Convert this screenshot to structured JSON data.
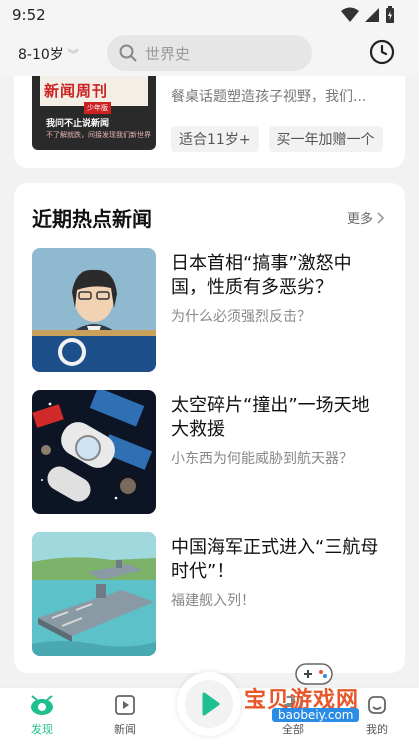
{
  "status_bar": {
    "time": "9:52"
  },
  "header": {
    "age_selector": "8-10岁",
    "search_placeholder": "世界史"
  },
  "featured_card": {
    "magazine": {
      "title": "新闻周刊",
      "edition": "少年版",
      "headline": "我问不止说新闻",
      "subline": "不了解就跌，间接发现我们新世界"
    },
    "description": "餐桌话题塑造孩子视野，我们...",
    "tags": [
      "适合11岁+",
      "买一年加赠一个"
    ]
  },
  "news_section": {
    "title": "近期热点新闻",
    "more_label": "更多",
    "items": [
      {
        "title": "日本首相“搞事”激怒中国，性质有多恶劣？",
        "subtitle": "为什么必须强烈反击？",
        "thumb_icon": "politician-podium-illustration"
      },
      {
        "title": "太空碎片“撞出”一场天地大救援",
        "subtitle": "小东西为何能威胁到航天器？",
        "thumb_icon": "space-station-illustration"
      },
      {
        "title": "中国海军正式进入“三航母时代”！",
        "subtitle": "福建舰入列！",
        "thumb_icon": "aircraft-carrier-illustration"
      }
    ]
  },
  "bottom_nav": {
    "items": [
      {
        "label": "发现",
        "active": true
      },
      {
        "label": "新闻",
        "active": false
      },
      {
        "label": "全部",
        "active": false
      },
      {
        "label": "我的",
        "active": false
      }
    ]
  },
  "watermark": {
    "text": "宝贝游戏网",
    "url": "baobeiy.com"
  },
  "colors": {
    "accent": "#1fbf8f",
    "background": "#f2f2f2",
    "card": "#ffffff"
  }
}
